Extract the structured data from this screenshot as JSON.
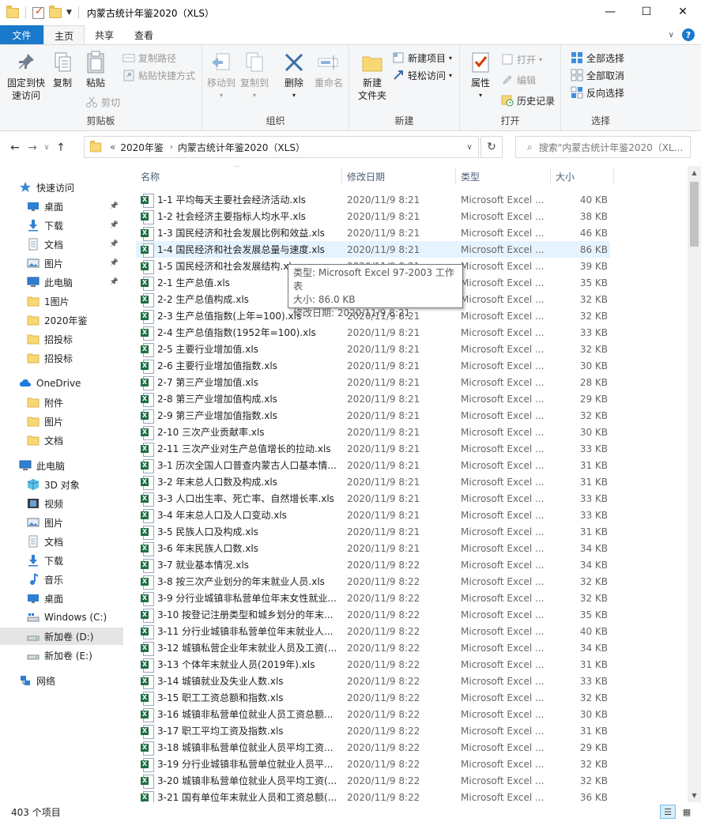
{
  "window": {
    "title": "内蒙古统计年鉴2020（XLS）",
    "min_glyph": "—",
    "max_glyph": "☐",
    "close_glyph": "✕"
  },
  "ribbon_tabs": {
    "file": "文件",
    "home": "主页",
    "share": "共享",
    "view": "查看"
  },
  "ribbon": {
    "clipboard": {
      "label": "剪贴板",
      "pin": "固定到快\n速访问",
      "copy": "复制",
      "paste": "粘贴",
      "copy_path": "复制路径",
      "paste_shortcut": "粘贴快捷方式",
      "cut": "剪切"
    },
    "organize": {
      "label": "组织",
      "move_to": "移动到",
      "copy_to": "复制到",
      "delete": "删除",
      "rename": "重命名"
    },
    "new": {
      "label": "新建",
      "new_folder": "新建\n文件夹",
      "new_item": "新建项目",
      "easy_access": "轻松访问"
    },
    "open": {
      "label": "打开",
      "properties": "属性",
      "open": "打开",
      "edit": "编辑",
      "history": "历史记录"
    },
    "select": {
      "label": "选择",
      "select_all": "全部选择",
      "select_none": "全部取消",
      "invert": "反向选择"
    }
  },
  "address": {
    "overflow": "«",
    "crumbs": [
      "2020年鉴",
      "内蒙古统计年鉴2020（XLS）"
    ],
    "search_placeholder": "搜索\"内蒙古统计年鉴2020（XL..."
  },
  "nav": {
    "quick_access": "快速访问",
    "items_quick": [
      "桌面",
      "下载",
      "文档",
      "图片",
      "此电脑",
      "1图片",
      "2020年鉴",
      "招投标",
      "招投标"
    ],
    "onedrive": "OneDrive",
    "items_onedrive": [
      "附件",
      "图片",
      "文档"
    ],
    "this_pc": "此电脑",
    "items_pc": [
      "3D 对象",
      "视频",
      "图片",
      "文档",
      "下载",
      "音乐",
      "桌面",
      "Windows (C:)",
      "新加卷 (D:)",
      "新加卷 (E:)"
    ],
    "network": "网络"
  },
  "columns": {
    "name": "名称",
    "date": "修改日期",
    "type": "类型",
    "size": "大小"
  },
  "files": [
    {
      "name": "1-1 平均每天主要社会经济活动.xls",
      "date": "2020/11/9 8:21",
      "type": "Microsoft Excel ...",
      "size": "40 KB"
    },
    {
      "name": "1-2 社会经济主要指标人均水平.xls",
      "date": "2020/11/9 8:21",
      "type": "Microsoft Excel ...",
      "size": "38 KB"
    },
    {
      "name": "1-3 国民经济和社会发展比例和效益.xls",
      "date": "2020/11/9 8:21",
      "type": "Microsoft Excel ...",
      "size": "46 KB"
    },
    {
      "name": "1-4 国民经济和社会发展总量与速度.xls",
      "date": "2020/11/9 8:21",
      "type": "Microsoft Excel ...",
      "size": "86 KB"
    },
    {
      "name": "1-5 国民经济和社会发展结构.xls",
      "date": "2020/11/9 8:21",
      "type": "Microsoft Excel ...",
      "size": "39 KB"
    },
    {
      "name": "2-1 生产总值.xls",
      "date": "2020/11/9 8:21",
      "type": "Microsoft Excel ...",
      "size": "35 KB"
    },
    {
      "name": "2-2 生产总值构成.xls",
      "date": "2020/11/9 8:21",
      "type": "Microsoft Excel ...",
      "size": "32 KB"
    },
    {
      "name": "2-3 生产总值指数(上年=100).xls",
      "date": "2020/11/9 8:21",
      "type": "Microsoft Excel ...",
      "size": "32 KB"
    },
    {
      "name": "2-4 生产总值指数(1952年=100).xls",
      "date": "2020/11/9 8:21",
      "type": "Microsoft Excel ...",
      "size": "33 KB"
    },
    {
      "name": "2-5 主要行业增加值.xls",
      "date": "2020/11/9 8:21",
      "type": "Microsoft Excel ...",
      "size": "32 KB"
    },
    {
      "name": "2-6 主要行业增加值指数.xls",
      "date": "2020/11/9 8:21",
      "type": "Microsoft Excel ...",
      "size": "30 KB"
    },
    {
      "name": "2-7 第三产业增加值.xls",
      "date": "2020/11/9 8:21",
      "type": "Microsoft Excel ...",
      "size": "28 KB"
    },
    {
      "name": "2-8 第三产业增加值构成.xls",
      "date": "2020/11/9 8:21",
      "type": "Microsoft Excel ...",
      "size": "29 KB"
    },
    {
      "name": "2-9 第三产业增加值指数.xls",
      "date": "2020/11/9 8:21",
      "type": "Microsoft Excel ...",
      "size": "32 KB"
    },
    {
      "name": "2-10 三次产业贡献率.xls",
      "date": "2020/11/9 8:21",
      "type": "Microsoft Excel ...",
      "size": "30 KB"
    },
    {
      "name": "2-11 三次产业对生产总值增长的拉动.xls",
      "date": "2020/11/9 8:21",
      "type": "Microsoft Excel ...",
      "size": "33 KB"
    },
    {
      "name": "3-1 历次全国人口普查内蒙古人口基本情...",
      "date": "2020/11/9 8:21",
      "type": "Microsoft Excel ...",
      "size": "31 KB"
    },
    {
      "name": "3-2 年末总人口数及构成.xls",
      "date": "2020/11/9 8:21",
      "type": "Microsoft Excel ...",
      "size": "31 KB"
    },
    {
      "name": "3-3 人口出生率、死亡率、自然增长率.xls",
      "date": "2020/11/9 8:21",
      "type": "Microsoft Excel ...",
      "size": "33 KB"
    },
    {
      "name": "3-4 年末总人口及人口变动.xls",
      "date": "2020/11/9 8:21",
      "type": "Microsoft Excel ...",
      "size": "33 KB"
    },
    {
      "name": "3-5 民族人口及构成.xls",
      "date": "2020/11/9 8:21",
      "type": "Microsoft Excel ...",
      "size": "31 KB"
    },
    {
      "name": "3-6 年末民族人口数.xls",
      "date": "2020/11/9 8:21",
      "type": "Microsoft Excel ...",
      "size": "34 KB"
    },
    {
      "name": "3-7 就业基本情况.xls",
      "date": "2020/11/9 8:22",
      "type": "Microsoft Excel ...",
      "size": "34 KB"
    },
    {
      "name": "3-8 按三次产业划分的年末就业人员.xls",
      "date": "2020/11/9 8:22",
      "type": "Microsoft Excel ...",
      "size": "32 KB"
    },
    {
      "name": "3-9 分行业城镇非私营单位年末女性就业...",
      "date": "2020/11/9 8:22",
      "type": "Microsoft Excel ...",
      "size": "32 KB"
    },
    {
      "name": "3-10 按登记注册类型和城乡划分的年末...",
      "date": "2020/11/9 8:22",
      "type": "Microsoft Excel ...",
      "size": "35 KB"
    },
    {
      "name": "3-11 分行业城镇非私营单位年末就业人...",
      "date": "2020/11/9 8:22",
      "type": "Microsoft Excel ...",
      "size": "40 KB"
    },
    {
      "name": "3-12 城镇私营企业年末就业人员及工资(...",
      "date": "2020/11/9 8:22",
      "type": "Microsoft Excel ...",
      "size": "34 KB"
    },
    {
      "name": "3-13 个体年末就业人员(2019年).xls",
      "date": "2020/11/9 8:22",
      "type": "Microsoft Excel ...",
      "size": "31 KB"
    },
    {
      "name": "3-14 城镇就业及失业人数.xls",
      "date": "2020/11/9 8:22",
      "type": "Microsoft Excel ...",
      "size": "33 KB"
    },
    {
      "name": "3-15 职工工资总额和指数.xls",
      "date": "2020/11/9 8:22",
      "type": "Microsoft Excel ...",
      "size": "32 KB"
    },
    {
      "name": "3-16 城镇非私营单位就业人员工资总额...",
      "date": "2020/11/9 8:22",
      "type": "Microsoft Excel ...",
      "size": "30 KB"
    },
    {
      "name": "3-17 职工平均工资及指数.xls",
      "date": "2020/11/9 8:22",
      "type": "Microsoft Excel ...",
      "size": "31 KB"
    },
    {
      "name": "3-18 城镇非私营单位就业人员平均工资...",
      "date": "2020/11/9 8:22",
      "type": "Microsoft Excel ...",
      "size": "29 KB"
    },
    {
      "name": "3-19 分行业城镇非私营单位就业人员平...",
      "date": "2020/11/9 8:22",
      "type": "Microsoft Excel ...",
      "size": "32 KB"
    },
    {
      "name": "3-20 城镇非私营单位就业人员平均工资(...",
      "date": "2020/11/9 8:22",
      "type": "Microsoft Excel ...",
      "size": "32 KB"
    },
    {
      "name": "3-21 国有单位年末就业人员和工资总额(...",
      "date": "2020/11/9 8:22",
      "type": "Microsoft Excel ...",
      "size": "36 KB"
    }
  ],
  "tooltip": {
    "type_line": "类型: Microsoft Excel 97-2003 工作表",
    "size_line": "大小: 86.0 KB",
    "date_line": "修改日期: 2020/11/9 8:21"
  },
  "status": {
    "count": "403 个项目"
  },
  "colors": {
    "accent": "#1979ca",
    "excel_green": "#1d7044",
    "hover_row": "#e5f3ff"
  }
}
